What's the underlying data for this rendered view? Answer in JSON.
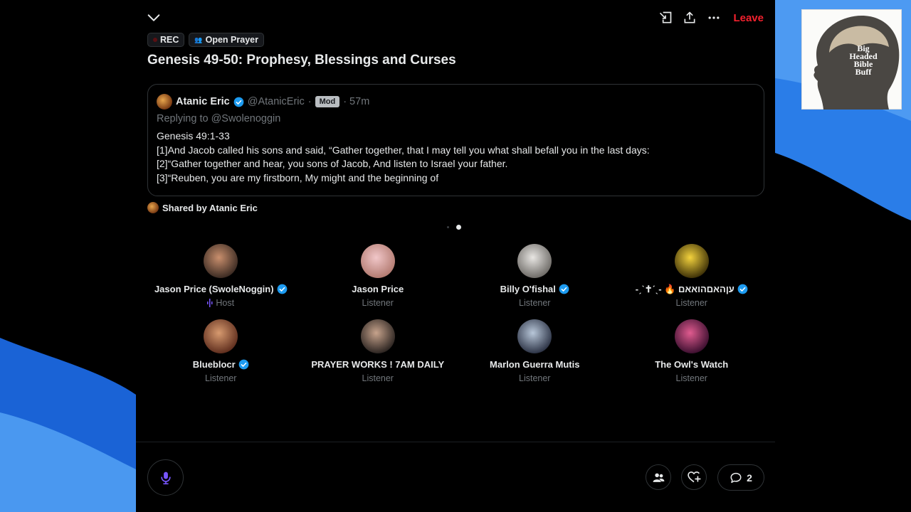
{
  "space": {
    "badges": {
      "rec": "REC",
      "topic": "Open Prayer"
    },
    "title": "Genesis 49-50: Prophesy, Blessings and Curses",
    "leave_label": "Leave"
  },
  "post": {
    "author_name": "Atanic Eric",
    "author_handle": "@AtanicEric",
    "separator": "·",
    "mod_badge": "Mod",
    "time": "· 57m",
    "replying": "Replying to @Swolenoggin",
    "lines": [
      "Genesis 49:1-33",
      "[1]And Jacob called his sons and said, “Gather together, that I may tell you what shall befall you in the last days:",
      "[2]“Gather together and hear, you sons of Jacob, And listen to Israel your father.",
      "[3]“Reuben, you are my firstborn, My might and the beginning of"
    ],
    "shared_by": "Shared by Atanic Eric"
  },
  "carousel": {
    "pages": 2,
    "active": 2
  },
  "participants": [
    {
      "name": "Jason Price (SwoleNoggin)",
      "role": "Host",
      "verified": true,
      "avatar_colors": [
        "#c98f6d",
        "#3a2a22"
      ]
    },
    {
      "name": "Jason Price",
      "role": "Listener",
      "verified": false,
      "avatar_colors": [
        "#f1c7c9",
        "#b27a70"
      ]
    },
    {
      "name": "Billy O'fishal",
      "role": "Listener",
      "verified": true,
      "avatar_colors": [
        "#e8e6e3",
        "#6d6a66"
      ]
    },
    {
      "name": "-ˏˋ✝ˊˎ- 🔥 עןהאםהואאם",
      "role": "Listener",
      "verified": true,
      "avatar_colors": [
        "#f3d23d",
        "#3d3007"
      ]
    },
    {
      "name": "Bluebloсr",
      "role": "Listener",
      "verified": true,
      "avatar_colors": [
        "#d79a6f",
        "#5e2d1d"
      ]
    },
    {
      "name": "PRAYER WORKS ! 7AM DAILY",
      "role": "Listener",
      "verified": false,
      "avatar_colors": [
        "#c7a38c",
        "#2a2320"
      ]
    },
    {
      "name": "Marlon Guerra Mutis",
      "role": "Listener",
      "verified": false,
      "avatar_colors": [
        "#b8c7d9",
        "#2b3244"
      ]
    },
    {
      "name": "The Owl's Watch",
      "role": "Listener",
      "verified": false,
      "avatar_colors": [
        "#e05b8f",
        "#3b0f2f"
      ]
    }
  ],
  "footer": {
    "comments_count": "2"
  },
  "thumbnail": {
    "text_lines": [
      "Big",
      "Headed",
      "Bible",
      "Buff"
    ]
  },
  "colors": {
    "accent_blue": "#1d9bf0",
    "leave_red": "#f4212e",
    "mic_purple": "#7856ff"
  }
}
